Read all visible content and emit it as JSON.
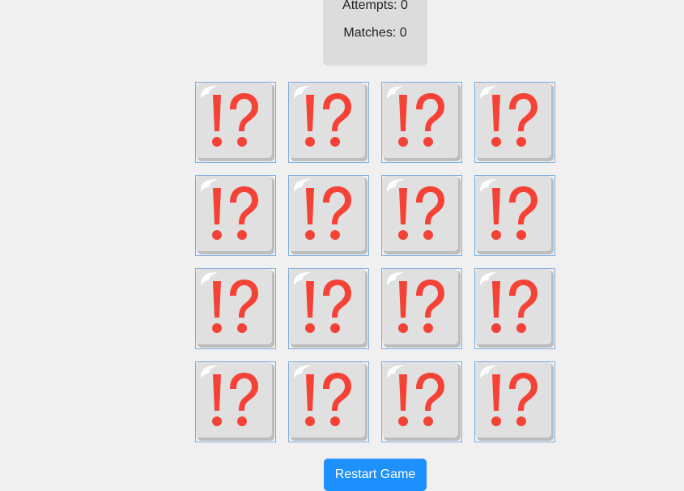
{
  "stats": {
    "attempts_label": "Attempts: 0",
    "matches_label": "Matches: 0",
    "attempts": 0,
    "matches": 0
  },
  "board": {
    "rows": 4,
    "columns": 4,
    "card_back_icon": "exclamation-question-mark-icon",
    "cards_face_down": 16
  },
  "controls": {
    "restart_label": "Restart Game"
  },
  "colors": {
    "background": "#f0f0f0",
    "stats_panel": "#dcdcdc",
    "card_border": "#7aaee0",
    "icon_red": "#f44336",
    "button": "#1e90ff"
  }
}
